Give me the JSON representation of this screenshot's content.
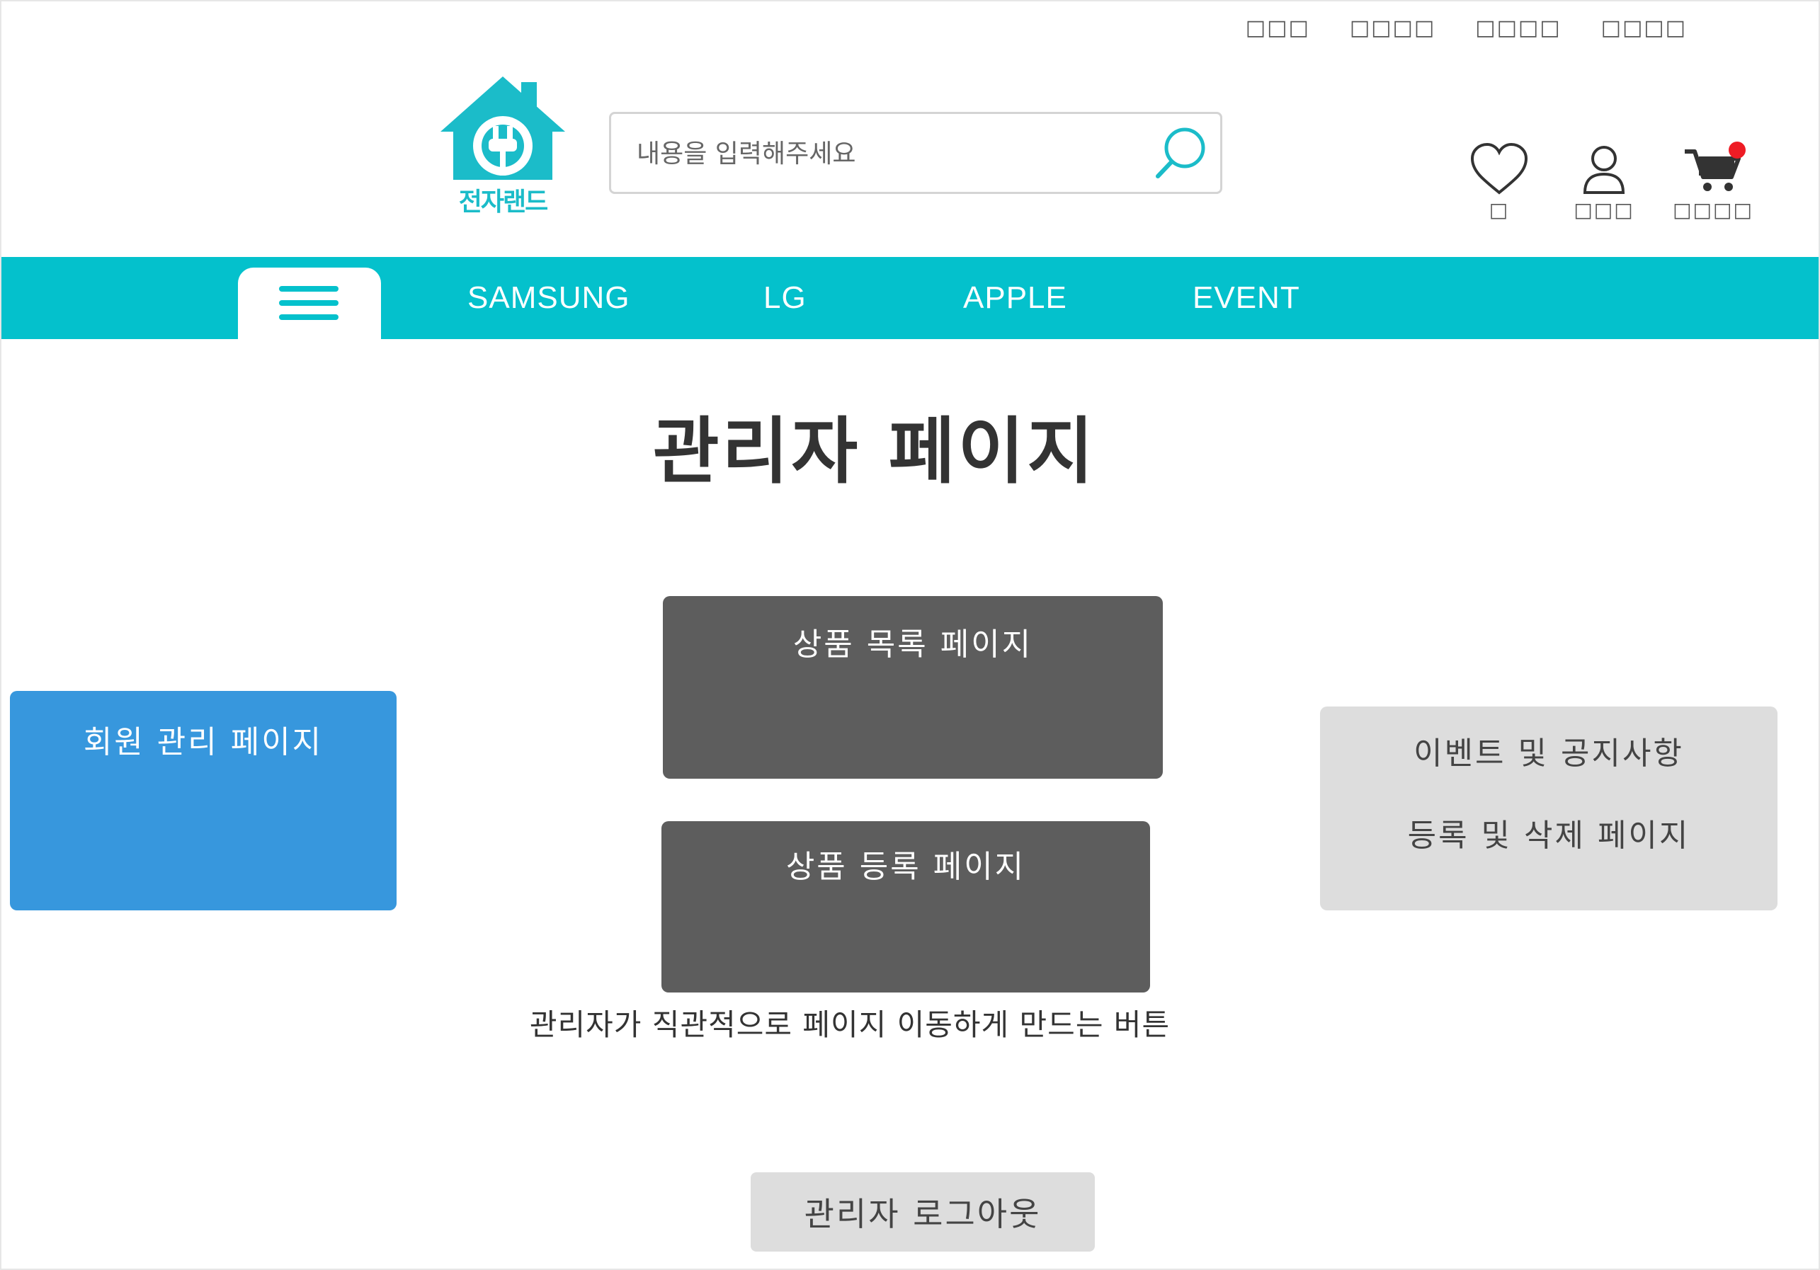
{
  "top_links": [
    "□□□",
    "□□□□",
    "□□□□",
    "□□□□"
  ],
  "logo": {
    "text": "전자랜드"
  },
  "search": {
    "placeholder": "내용을 입력해주세요"
  },
  "header_icons": {
    "wish_label": "□",
    "mypage_label": "□□□",
    "cart_label": "□□□□"
  },
  "nav": {
    "items": [
      "SAMSUNG",
      "LG",
      "APPLE",
      "EVENT"
    ]
  },
  "page": {
    "title": "관리자 페이지"
  },
  "buttons": {
    "members": "회원 관리 페이지",
    "product_list": "상품 목록 페이지",
    "product_register": "상품 등록 페이지",
    "events_line1": "이벤트 및 공지사항",
    "events_line2": "등록 및 삭제 페이지",
    "logout": "관리자 로그아웃"
  },
  "caption": "관리자가 직관적으로 페이지 이동하게 만드는 버튼",
  "colors": {
    "brand_teal": "#04c1cc",
    "members_blue": "#3797dd",
    "dark_gray": "#5d5d5d",
    "light_gray": "#dddddd",
    "cart_badge": "#ee1c25"
  }
}
